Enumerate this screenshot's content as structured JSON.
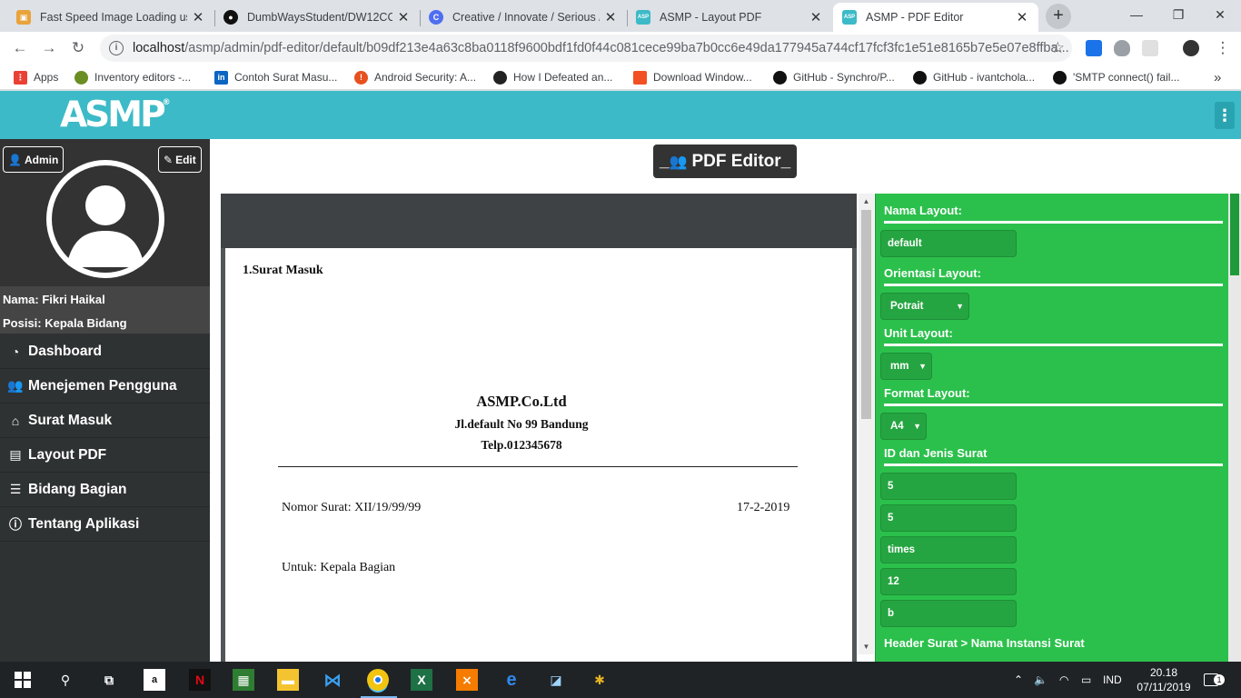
{
  "browser": {
    "tabs": [
      {
        "title": "Fast Speed Image Loading usi",
        "icon": "tab-favicon-image-icon",
        "color": "#e8a33b"
      },
      {
        "title": "DumbWaysStudent/DW12CCJ(",
        "icon": "github-icon",
        "color": "#111111"
      },
      {
        "title": "Creative / Innovate / Serious /",
        "icon": "creative-icon",
        "color": "#4f6ef0"
      },
      {
        "title": "ASMP - Layout PDF",
        "icon": "asmp-favicon-icon",
        "color": "#3cbac7"
      },
      {
        "title": "ASMP - PDF Editor",
        "icon": "asmp-favicon-icon",
        "color": "#3cbac7"
      }
    ],
    "url_host": "localhost",
    "url_path": "/asmp/admin/pdf-editor/default/b09df213e4a63c8ba0118f9600bdf1fd0f44c081cece99ba7b0cc6e49da177945a744cf17fcf3fc1e51e8165b7e5e07e8ffba...",
    "bookmarks": [
      {
        "label": "Apps",
        "color": "#e94235"
      },
      {
        "label": "Inventory editors -...",
        "color": "#6b8e23"
      },
      {
        "label": "Contoh Surat Masu...",
        "color": "#0a66c2"
      },
      {
        "label": "Android Security: A...",
        "color": "#e8501e"
      },
      {
        "label": "How I Defeated an...",
        "color": "#222222"
      },
      {
        "label": "Download Window...",
        "color": "#f25022"
      },
      {
        "label": "GitHub - Synchro/P...",
        "color": "#111111"
      },
      {
        "label": "GitHub - ivantchola...",
        "color": "#111111"
      },
      {
        "label": "'SMTP connect() fail...",
        "color": "#111111"
      }
    ]
  },
  "app": {
    "logo": "ASMP",
    "logo_mark": "®"
  },
  "profile": {
    "admin_label": "Admin",
    "edit_label": "Edit",
    "name_line": "Nama: Fikri Haikal",
    "position_line": "Posisi: Kepala Bidang"
  },
  "menu": [
    {
      "label": "Dashboard",
      "icon": "dashboard-icon"
    },
    {
      "label": "Menejemen Pengguna",
      "icon": "users-icon"
    },
    {
      "label": "Surat Masuk",
      "icon": "inbox-icon"
    },
    {
      "label": "Layout PDF",
      "icon": "pdf-file-icon"
    },
    {
      "label": "Bidang Bagian",
      "icon": "list-icon"
    },
    {
      "label": "Tentang Aplikasi",
      "icon": "info-icon"
    }
  ],
  "page_title": "PDF Editor_",
  "page_title_prefix": "_",
  "pdf": {
    "heading": "1.Surat Masuk",
    "company": "ASMP.Co.Ltd",
    "address": "Jl.default No 99 Bandung",
    "phone": "Telp.012345678",
    "nomor": "Nomor Surat: XII/19/99/99",
    "date": "17-2-2019",
    "untuk": "Untuk: Kepala Bagian"
  },
  "settings": {
    "nama_layout_label": "Nama Layout:",
    "nama_layout_value": "default",
    "orientasi_label": "Orientasi Layout:",
    "orientasi_value": "Potrait",
    "unit_label": "Unit Layout:",
    "unit_value": "mm",
    "format_label": "Format Layout:",
    "format_value": "A4",
    "id_jenis_label": "ID dan Jenis Surat",
    "id_jenis_fields": [
      "5",
      "5",
      "times",
      "12",
      "b"
    ],
    "header_label": "Header Surat > Nama Instansi Surat"
  },
  "taskbar": {
    "lang": "IND",
    "time": "20.18",
    "date": "07/11/2019",
    "notif_count": "1"
  },
  "colors": {
    "accent": "#3cbac7",
    "sidebar": "#2f3232",
    "panel": "#2bc04c"
  }
}
